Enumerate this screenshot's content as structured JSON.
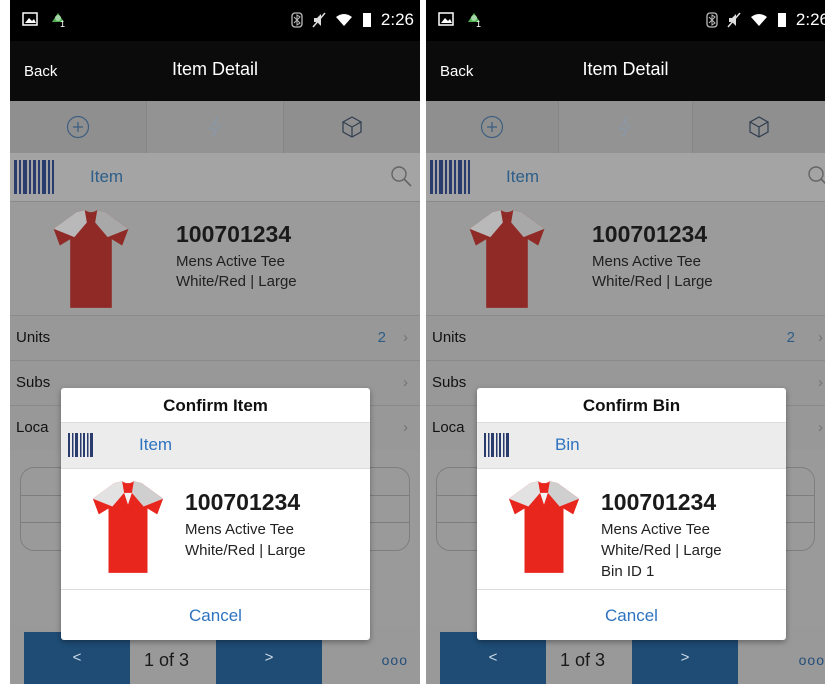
{
  "status_bar": {
    "time": "2:26"
  },
  "screens": [
    {
      "header": {
        "back_label": "Back",
        "title": "Item Detail"
      },
      "scan_label": "Item",
      "item": {
        "sku": "100701234",
        "description": "Mens Active Tee",
        "variant": "White/Red | Large"
      },
      "list": [
        {
          "label": "Units",
          "value": "2"
        },
        {
          "label": "Subs",
          "value": ""
        },
        {
          "label": "Loca",
          "value": ""
        }
      ],
      "pager": {
        "prev": "<",
        "next": ">",
        "info": "1 of 3",
        "more": "ooo"
      },
      "dialog": {
        "title": "Confirm Item",
        "scan_label": "Item",
        "sku": "100701234",
        "description": "Mens Active Tee",
        "variant": "White/Red | Large",
        "extra": "",
        "cancel": "Cancel"
      }
    },
    {
      "header": {
        "back_label": "Back",
        "title": "Item Detail"
      },
      "scan_label": "Item",
      "item": {
        "sku": "100701234",
        "description": "Mens Active Tee",
        "variant": "White/Red | Large"
      },
      "list": [
        {
          "label": "Units",
          "value": "2"
        },
        {
          "label": "Subs",
          "value": ""
        },
        {
          "label": "Loca",
          "value": ""
        }
      ],
      "pager": {
        "prev": "<",
        "next": ">",
        "info": "1 of 3",
        "more": "ooo"
      },
      "dialog": {
        "title": "Confirm Bin",
        "scan_label": "Bin",
        "sku": "100701234",
        "description": "Mens Active Tee",
        "variant": "White/Red | Large",
        "extra": "Bin ID 1",
        "cancel": "Cancel"
      }
    }
  ]
}
